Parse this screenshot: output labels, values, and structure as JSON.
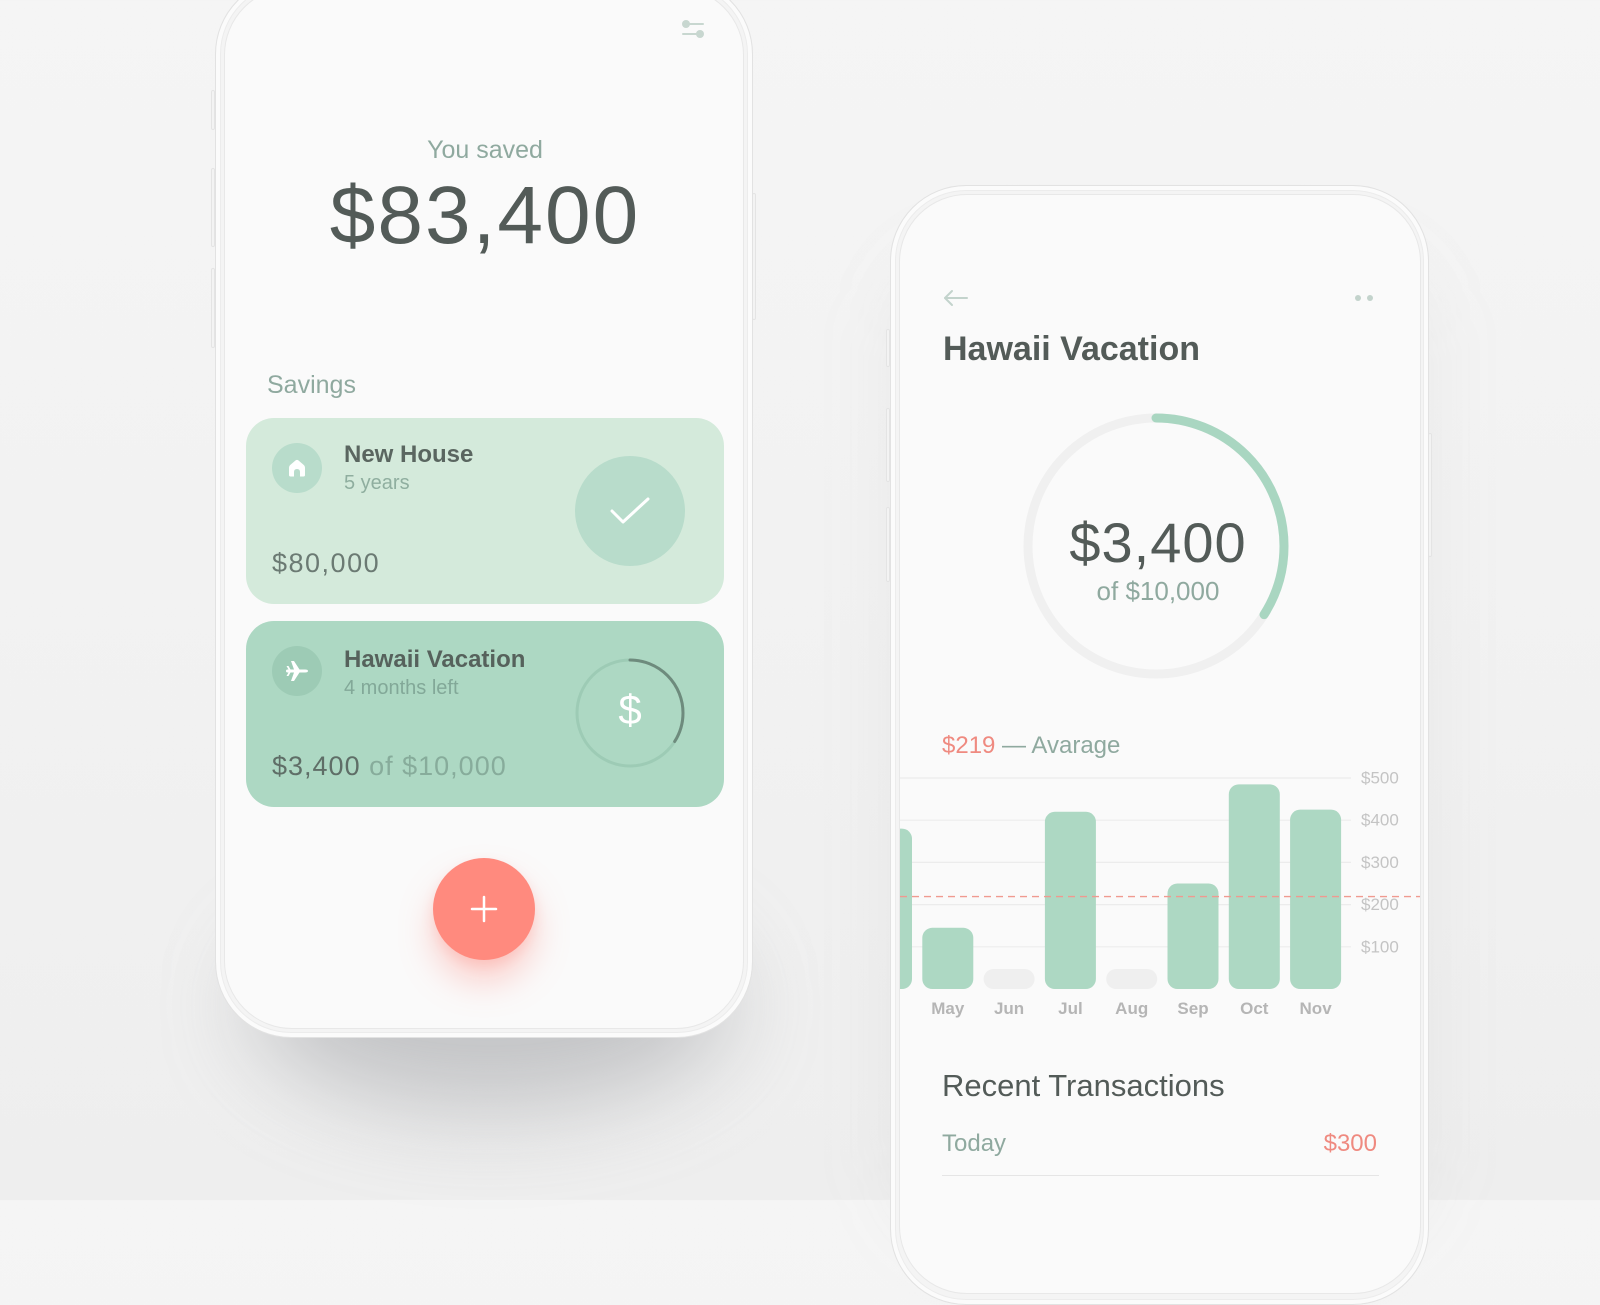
{
  "colors": {
    "accent_coral": "#ff8a7e",
    "accent_red_text": "#ef8a80",
    "mint_light": "#d4eadb",
    "mint": "#add8c3",
    "text_dark": "#535b58",
    "text_muted": "#8fa99f"
  },
  "left_phone": {
    "header": {
      "filter_icon": "sliders-icon"
    },
    "summary": {
      "label": "You saved",
      "amount": "$83,400"
    },
    "savings": {
      "heading": "Savings",
      "goals": [
        {
          "name": "New House",
          "subtitle": "5 years",
          "amount": "$80,000",
          "icon": "house-icon",
          "status": "completed",
          "status_icon": "check-icon",
          "color": "#d4eadb"
        },
        {
          "name": "Hawaii Vacation",
          "subtitle": "4 months left",
          "amount": "$3,400",
          "target_text": "of $10,000",
          "icon": "airplane-icon",
          "status": "in-progress",
          "progress": 0.34,
          "ring_symbol": "$",
          "color": "#add8c3"
        }
      ]
    },
    "fab": {
      "label": "+",
      "icon": "plus-icon"
    }
  },
  "right_phone": {
    "nav": {
      "back_icon": "arrow-left-icon",
      "more_icon": "more-dots-icon"
    },
    "title": "Hawaii Vacation",
    "progress": {
      "amount": "$3,400",
      "target_text": "of $10,000",
      "fraction": 0.34
    },
    "average": {
      "value": "$219",
      "separator": " — ",
      "label": "Avarage"
    },
    "transactions": {
      "heading": "Recent Transactions",
      "items": [
        {
          "date": "Today",
          "amount": "$300"
        }
      ]
    }
  },
  "chart_data": {
    "type": "bar",
    "title": "",
    "xlabel": "",
    "ylabel": "",
    "categories": [
      "",
      "May",
      "Jun",
      "Jul",
      "Aug",
      "Sep",
      "Oct",
      "Nov"
    ],
    "values": [
      380,
      145,
      null,
      420,
      null,
      250,
      485,
      425
    ],
    "ylim": [
      0,
      500
    ],
    "yticks": [
      100,
      200,
      300,
      400,
      500
    ],
    "ytick_labels": [
      "$100",
      "$200",
      "$300",
      "$400",
      "$500"
    ],
    "average": 219,
    "average_label": "$219 — Avarage",
    "grid": true,
    "y_axis_side": "right",
    "notes": "first bar partially scrolled off the left edge; Jun and Aug shown as empty placeholders"
  }
}
